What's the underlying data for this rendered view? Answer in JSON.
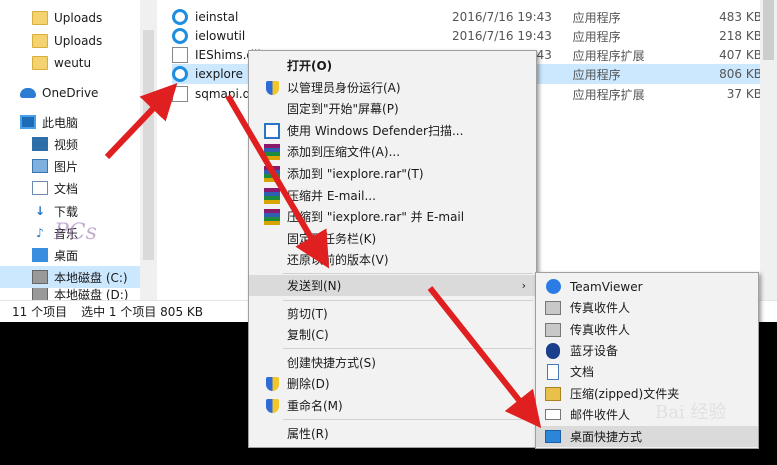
{
  "nav_pane": {
    "items": [
      {
        "label": "Uploads",
        "icon": "folder-icon"
      },
      {
        "label": "Uploads",
        "icon": "folder-icon"
      },
      {
        "label": "weutu",
        "icon": "folder-icon"
      },
      {
        "label": "OneDrive",
        "icon": "onedrive-icon"
      },
      {
        "label": "此电脑",
        "icon": "this-pc-icon"
      },
      {
        "label": "视频",
        "icon": "video-icon"
      },
      {
        "label": "图片",
        "icon": "pictures-icon"
      },
      {
        "label": "文档",
        "icon": "documents-icon"
      },
      {
        "label": "下载",
        "icon": "download-icon"
      },
      {
        "label": "音乐",
        "icon": "music-icon"
      },
      {
        "label": "桌面",
        "icon": "desktop-icon"
      },
      {
        "label": "本地磁盘 (C:)",
        "icon": "disk-icon"
      },
      {
        "label": "本地磁盘 (D:)",
        "icon": "disk-icon"
      }
    ]
  },
  "file_list": {
    "rows": [
      {
        "name": "ieinstal",
        "date": "2016/7/16 19:43",
        "type": "应用程序",
        "size": "483 KB",
        "icon": "ie-icon"
      },
      {
        "name": "ielowutil",
        "date": "2016/7/16 19:43",
        "type": "应用程序",
        "size": "218 KB",
        "icon": "ie-icon"
      },
      {
        "name": "IEShims.dll",
        "date": "2016/7/16 19:43",
        "type": "应用程序扩展",
        "size": "407 KB",
        "icon": "dll-icon"
      },
      {
        "name": "iexplore",
        "date": "",
        "type": "应用程序",
        "size": "806 KB",
        "icon": "ie-icon"
      },
      {
        "name": "sqmapi.dll",
        "date": "",
        "type": "应用程序扩展",
        "size": "37 KB",
        "icon": "dll-icon"
      }
    ]
  },
  "status_bar": {
    "item_count": "11 个项目",
    "selection": "选中 1 个项目  805 KB"
  },
  "context_menu": {
    "items": [
      {
        "label": "打开(O)",
        "icon": "",
        "bold": true
      },
      {
        "label": "以管理员身份运行(A)",
        "icon": "uac-shield-icon"
      },
      {
        "label": "固定到\"开始\"屏幕(P)",
        "icon": ""
      },
      {
        "label": "使用 Windows Defender扫描...",
        "icon": "windows-defender-icon"
      },
      {
        "label": "添加到压缩文件(A)...",
        "icon": "winrar-icon"
      },
      {
        "label": "添加到 \"iexplore.rar\"(T)",
        "icon": "winrar-icon"
      },
      {
        "label": "压缩并 E-mail...",
        "icon": "winrar-icon"
      },
      {
        "label": "压缩到 \"iexplore.rar\" 并 E-mail",
        "icon": "winrar-icon"
      },
      {
        "label": "固定到任务栏(K)",
        "icon": ""
      },
      {
        "label": "还原以前的版本(V)",
        "icon": ""
      },
      {
        "label": "发送到(N)",
        "icon": "",
        "submenu": true
      },
      {
        "label": "剪切(T)",
        "icon": ""
      },
      {
        "label": "复制(C)",
        "icon": ""
      },
      {
        "label": "创建快捷方式(S)",
        "icon": ""
      },
      {
        "label": "删除(D)",
        "icon": "uac-shield-icon"
      },
      {
        "label": "重命名(M)",
        "icon": "uac-shield-icon"
      },
      {
        "label": "属性(R)",
        "icon": ""
      }
    ],
    "submenu_arrow": "›"
  },
  "send_to_menu": {
    "items": [
      {
        "label": "TeamViewer",
        "icon": "teamviewer-icon"
      },
      {
        "label": "传真收件人",
        "icon": "fax-icon"
      },
      {
        "label": "传真收件人",
        "icon": "fax-icon"
      },
      {
        "label": "蓝牙设备",
        "icon": "bluetooth-icon"
      },
      {
        "label": "文档",
        "icon": "documents-icon"
      },
      {
        "label": "压缩(zipped)文件夹",
        "icon": "zip-folder-icon"
      },
      {
        "label": "邮件收件人",
        "icon": "mail-icon"
      },
      {
        "label": "桌面快捷方式",
        "icon": "desktop-shortcut-icon"
      }
    ]
  },
  "watermarks": {
    "left": "PCs",
    "right": "Bai 经验"
  },
  "colors": {
    "selection": "#cce8ff",
    "menu_bg": "#f2f2f2",
    "menu_highlight": "#dadada",
    "arrow": "#e02020"
  }
}
